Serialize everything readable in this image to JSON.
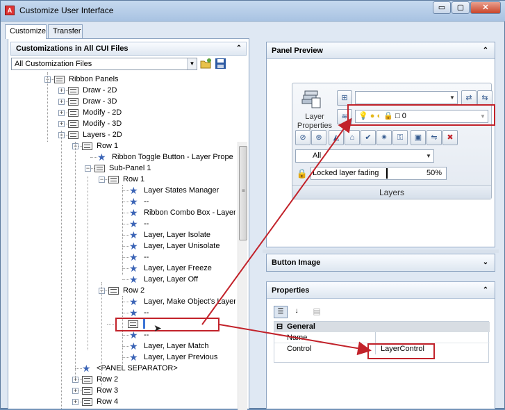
{
  "window": {
    "title": "Customize User Interface",
    "min_glyph": "▭",
    "max_glyph": "▢",
    "close_glyph": "✕"
  },
  "tabs": [
    "Customize",
    "Transfer"
  ],
  "left": {
    "header": "Customizations in All CUI Files",
    "collapse_glyph": "⌃",
    "filter": "All Customization Files",
    "filter_arrow": "▼",
    "tree": [
      {
        "label": "Ribbon Panels",
        "kind": "node",
        "exp": "−"
      },
      {
        "label": "Draw - 2D",
        "kind": "node",
        "exp": "+"
      },
      {
        "label": "Draw - 3D",
        "kind": "node",
        "exp": "+"
      },
      {
        "label": "Modify - 2D",
        "kind": "node",
        "exp": "+"
      },
      {
        "label": "Modify - 3D",
        "kind": "node",
        "exp": "+"
      },
      {
        "label": "Layers - 2D",
        "kind": "node",
        "exp": "−"
      },
      {
        "label": "Row 1",
        "kind": "row",
        "exp": "−"
      },
      {
        "label": "Ribbon Toggle Button - Layer Prope",
        "kind": "cmd"
      },
      {
        "label": "Sub-Panel 1",
        "kind": "sub",
        "exp": "−"
      },
      {
        "label": "Row 1",
        "kind": "row",
        "exp": "−"
      },
      {
        "label": "Layer States Manager",
        "kind": "cmd"
      },
      {
        "label": "--",
        "kind": "cmd"
      },
      {
        "label": "Ribbon Combo Box - Layer",
        "kind": "cmd"
      },
      {
        "label": "--",
        "kind": "cmd"
      },
      {
        "label": "Layer, Layer Isolate",
        "kind": "cmd"
      },
      {
        "label": "Layer, Layer Unisolate",
        "kind": "cmd"
      },
      {
        "label": "--",
        "kind": "cmd"
      },
      {
        "label": "Layer, Layer Freeze",
        "kind": "cmd"
      },
      {
        "label": "Layer, Layer Off",
        "kind": "cmd"
      },
      {
        "label": "Row 2",
        "kind": "row",
        "exp": "−"
      },
      {
        "label": "Layer, Make Object's Layer",
        "kind": "cmd"
      },
      {
        "label": "--",
        "kind": "cmd"
      },
      {
        "label": "",
        "kind": "drop"
      },
      {
        "label": "--",
        "kind": "cmd"
      },
      {
        "label": "Layer, Layer Match",
        "kind": "cmd"
      },
      {
        "label": "Layer, Layer Previous",
        "kind": "cmd"
      },
      {
        "label": "<PANEL SEPARATOR>",
        "kind": "cmd"
      },
      {
        "label": "Row 2",
        "kind": "row",
        "exp": "+"
      },
      {
        "label": "Row 3",
        "kind": "row",
        "exp": "+"
      },
      {
        "label": "Row 4",
        "kind": "row",
        "exp": "+"
      }
    ]
  },
  "preview": {
    "header": "Panel Preview",
    "layer_props_label": "Layer Properties",
    "layer_value": "0",
    "filter_value": "All",
    "fading_label": "Locked layer fading",
    "fading_value": "50%",
    "panel_title": "Layers"
  },
  "button_image": {
    "header": "Button Image"
  },
  "properties": {
    "header": "Properties",
    "group": "General",
    "group_toggle": "⊟",
    "rows": [
      {
        "name": "Name",
        "value": ""
      },
      {
        "name": "Control",
        "value": "LayerControl"
      }
    ]
  },
  "colors": {
    "highlight_box": "#c2222a",
    "accent": "#3b64b6"
  }
}
